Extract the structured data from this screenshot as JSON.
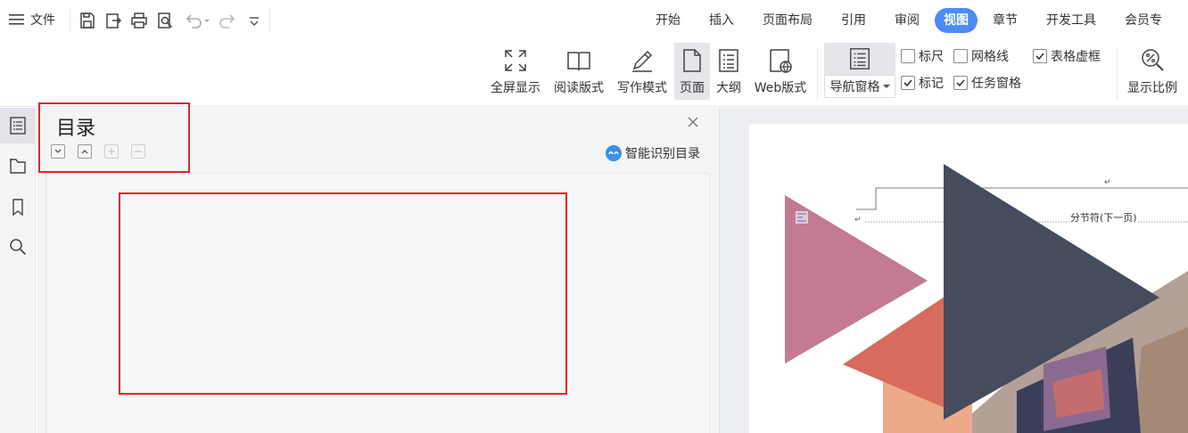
{
  "menu": {
    "label": "文件"
  },
  "tabs": [
    {
      "label": "开始",
      "active": false
    },
    {
      "label": "插入",
      "active": false
    },
    {
      "label": "页面布局",
      "active": false
    },
    {
      "label": "引用",
      "active": false
    },
    {
      "label": "审阅",
      "active": false
    },
    {
      "label": "视图",
      "active": true
    },
    {
      "label": "章节",
      "active": false
    },
    {
      "label": "开发工具",
      "active": false
    },
    {
      "label": "会员专",
      "active": false
    }
  ],
  "ribbon": {
    "fullscreen": "全屏显示",
    "reading": "阅读版式",
    "writing": "写作模式",
    "page": "页面",
    "outline": "大纲",
    "web": "Web版式",
    "nav_pane": "导航窗格",
    "ruler": "标尺",
    "gridlines": "网格线",
    "table_gridlines": "表格虚框",
    "marks": "标记",
    "task_pane": "任务窗格",
    "zoom": "显示比例"
  },
  "checkboxes": {
    "ruler": false,
    "gridlines": false,
    "table_gridlines": true,
    "marks": true,
    "task_pane": true
  },
  "nav": {
    "title": "目录",
    "smart_toc": "智能识别目录"
  },
  "document": {
    "section_break": "分节符(下一页)"
  },
  "colors": {
    "accent": "#4a8bf5",
    "highlight": "#e0262d",
    "triangle_pink": "#c37b92",
    "triangle_dark": "#444c5e",
    "triangle_coral": "#d86b5d",
    "triangle_peach": "#ebab88"
  }
}
